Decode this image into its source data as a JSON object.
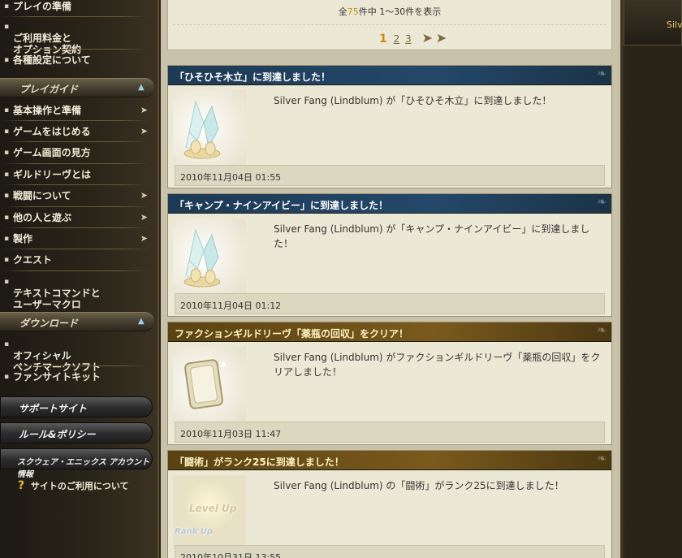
{
  "sidebar": {
    "top_items": [
      {
        "label": "プレイの準備",
        "chevron": false
      },
      {
        "label": "ご利用料金と\nオプション契約",
        "chevron": false
      },
      {
        "label": "各種設定について",
        "chevron": false
      }
    ],
    "play_guide": {
      "title": "プレイガイド",
      "items": [
        {
          "label": "基本操作と準備",
          "chevron": true
        },
        {
          "label": "ゲームをはじめる",
          "chevron": true
        },
        {
          "label": "ゲーム画面の見方",
          "chevron": false
        },
        {
          "label": "ギルドリーヴとは",
          "chevron": false
        },
        {
          "label": "戦闘について",
          "chevron": true
        },
        {
          "label": "他の人と遊ぶ",
          "chevron": true
        },
        {
          "label": "製作",
          "chevron": true
        },
        {
          "label": "クエスト",
          "chevron": false
        },
        {
          "label": "テキストコマンドと\nユーザーマクロ",
          "chevron": false
        }
      ]
    },
    "download": {
      "title": "ダウンロード",
      "items": [
        {
          "label": "オフィシャル\nベンチマークソフト",
          "chevron": false
        },
        {
          "label": "ファンサイトキット",
          "chevron": false
        }
      ]
    },
    "buttons": {
      "support": "サポートサイト",
      "rules": "ルール&ポリシー",
      "account": "スクウェア・エニックス アカウント情報"
    },
    "help_link": "サイトのご利用について"
  },
  "pager": {
    "summary_prefix": "全",
    "total": "75",
    "summary_suffix": "件中  1～30件を表示",
    "current_page": "1",
    "pages": [
      "2",
      "3"
    ]
  },
  "entries": [
    {
      "title": "「ひそひそ木立」に到達しました！",
      "style": "blue",
      "text": "Silver Fang (Lindblum) が「ひそひそ木立」に到達しました！",
      "date": "2010年11月04日 01:55",
      "thumb": "crystal-icon"
    },
    {
      "title": "「キャンプ・ナインアイビー」に到達しました！",
      "style": "blue",
      "text": "Silver Fang (Lindblum) が「キャンプ・ナインアイビー」に到達しました！",
      "date": "2010年11月04日 01:12",
      "thumb": "crystal-icon"
    },
    {
      "title": "ファクションギルドリーヴ「薬瓶の回収」をクリア！",
      "style": "gold",
      "text": "Silver Fang (Lindblum) がファクションギルドリーヴ「薬瓶の回収」をクリアしました！",
      "date": "2010年11月03日 11:47",
      "thumb": "leve-card-icon"
    },
    {
      "title": "「闘術」がランク25に到達しました！",
      "style": "gold",
      "text": "Silver Fang (Lindblum) の「闘術」がランク25に到達しました！",
      "date": "2010年10月31日 13:55",
      "thumb": "level-up-icon",
      "thumb_text_1": "Level Up",
      "thumb_text_2": "Rank Up"
    }
  ],
  "right_panel": {
    "name_fragment": "Silve"
  }
}
